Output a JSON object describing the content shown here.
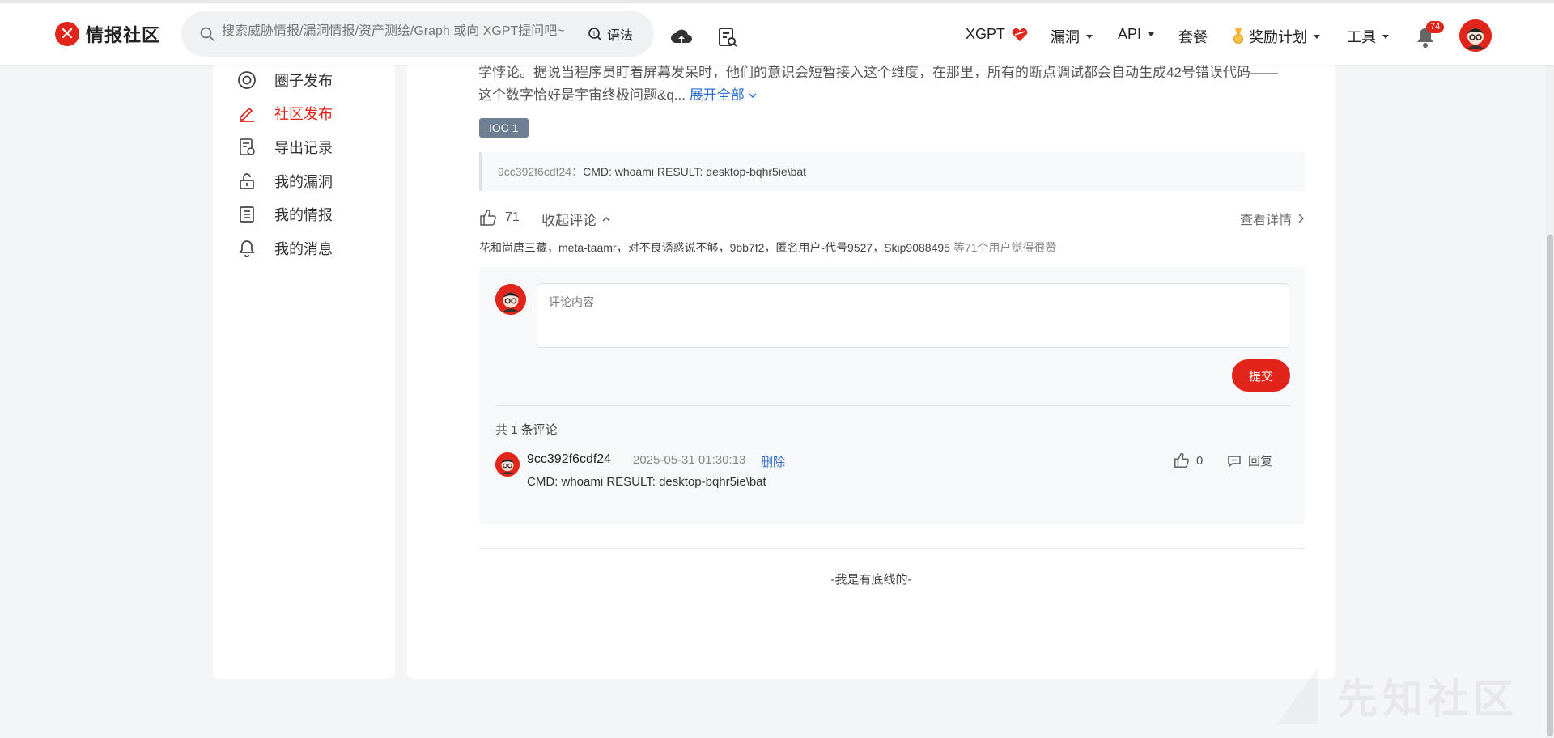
{
  "header": {
    "logo_text": "情报社区",
    "search_placeholder": "搜索威胁情报/漏洞情报/资产测绘/Graph 或向 XGPT提问吧~",
    "syntax_label": "语法",
    "nav": [
      {
        "label": "XGPT",
        "has_caret": false
      },
      {
        "label": "漏洞",
        "has_caret": true
      },
      {
        "label": "API",
        "has_caret": true
      },
      {
        "label": "套餐",
        "has_caret": false
      },
      {
        "label": "奖励计划",
        "has_caret": true
      },
      {
        "label": "工具",
        "has_caret": true
      }
    ],
    "notification_count": "74"
  },
  "sidebar": {
    "items": [
      {
        "label": "圈子发布",
        "icon": "target-icon"
      },
      {
        "label": "社区发布",
        "icon": "pen-icon",
        "active": true
      },
      {
        "label": "导出记录",
        "icon": "export-record-icon"
      },
      {
        "label": "我的漏洞",
        "icon": "unlock-icon"
      },
      {
        "label": "我的情报",
        "icon": "list-doc-icon"
      },
      {
        "label": "我的消息",
        "icon": "bell-icon"
      }
    ]
  },
  "post": {
    "description_line1": "学悖论。据说当程序员盯着屏幕发呆时，他们的意识会短暂接入这个维度，在那里，所有的断点调试都会自动生成42号错误代码——",
    "description_line2": "这个数字恰好是宇宙终极问题&q...",
    "expand_label": "展开全部",
    "ioc_tag": "IOC 1",
    "ioc_key": "9cc392f6cdf24",
    "ioc_sep": "：",
    "ioc_value": "CMD: whoami RESULT: desktop-bqhr5ie\\bat",
    "like_count": "71",
    "fold_label": "收起评论",
    "detail_label": "查看详情",
    "likers_names": "花和尚唐三藏，meta-taamr，对不良诱惑说不够，9bb7f2，匿名用户-代号9527，Skip9088495",
    "likers_suffix": " 等71个用户觉得很赞"
  },
  "comments": {
    "input_placeholder": "评论内容",
    "submit_label": "提交",
    "count_label": "共 1 条评论",
    "items": [
      {
        "user": "9cc392f6cdf24",
        "time": "2025-05-31 01:30:13",
        "delete_label": "删除",
        "text": "CMD: whoami RESULT: desktop-bqhr5ie\\bat",
        "likes": "0",
        "reply_label": "回复"
      }
    ]
  },
  "footer": {
    "end_text": "-我是有底线的-",
    "watermark": "先知社区"
  },
  "colors": {
    "brand_red": "#e1251b",
    "link_blue": "#2d6dcc"
  }
}
